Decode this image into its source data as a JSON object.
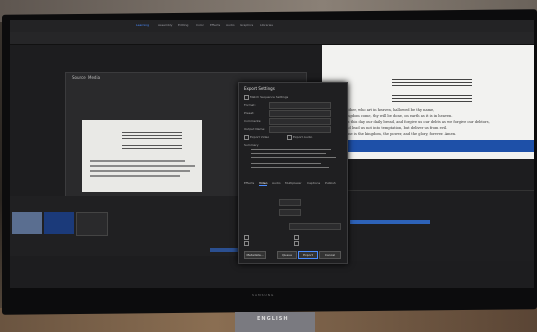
{
  "menu": {
    "items": [
      "Learning",
      "Assembly",
      "Editing",
      "Color",
      "Effects",
      "Audio",
      "Graphics",
      "Libraries"
    ],
    "active_index": 0
  },
  "media_panel": {
    "tab_a": "Source",
    "tab_b": "Media"
  },
  "export_dialog": {
    "title": "Export Settings",
    "labels": [
      "Match Sequence Settings",
      "Format:",
      "Preset:",
      "Comments:",
      "Output Name:",
      "Export Video",
      "Export Audio",
      "Summary"
    ],
    "tabs": [
      "Effects",
      "Video",
      "Audio",
      "Multiplexer",
      "Captions",
      "Publish"
    ],
    "active_tab": 1,
    "buttons": [
      "Metadata...",
      "Queue",
      "Export",
      "Cancel"
    ]
  },
  "program_monitor": {
    "lines": [
      "Our Father, who art in heaven, hallowed be thy name,",
      "Thy kingdom come, thy will be done, on earth as it is in heaven.",
      "Give us this day our daily bread, and forgive us our debts as we forgive our debtors,",
      "and lead us not into temptation, but deliver us from evil.",
      "For thine is the kingdom, the power, and the glory, forever. Amen."
    ]
  },
  "monitor_brand": "SAMSUNG",
  "stand_label": "ENGLISH",
  "colors": {
    "accent": "#4b8cff",
    "banner_blue": "#1e50a8"
  }
}
